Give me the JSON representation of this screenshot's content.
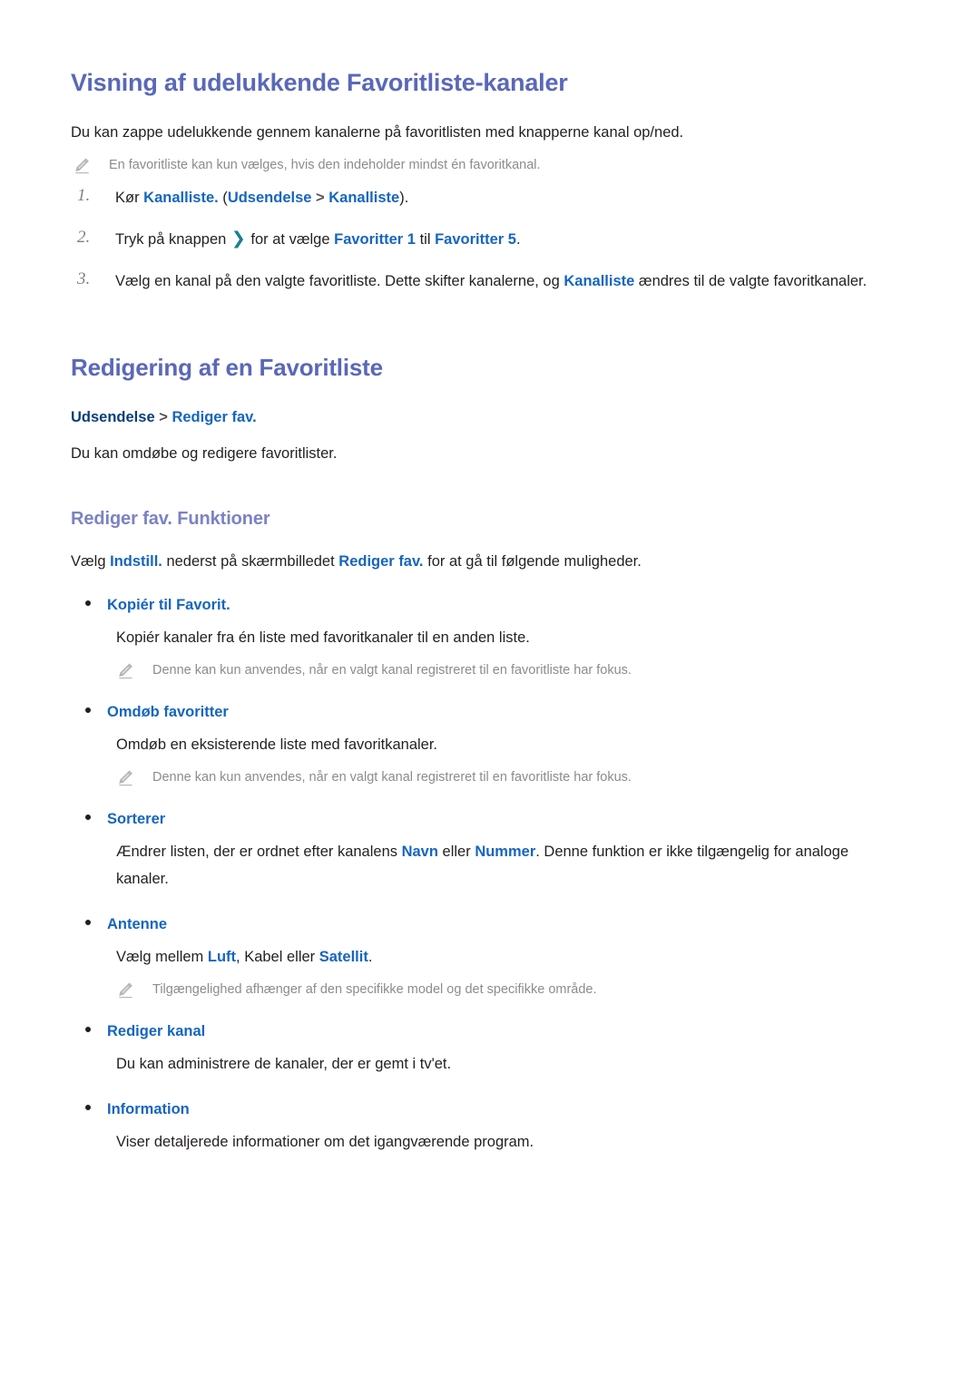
{
  "section1": {
    "heading": "Visning af udelukkende Favoritliste-kanaler",
    "intro": "Du kan zappe udelukkende gennem kanalerne på favoritlisten med knapperne kanal op/ned.",
    "note": "En favoritliste kan kun vælges, hvis den indeholder mindst én favoritkanal.",
    "steps": [
      {
        "number": "1.",
        "parts": [
          {
            "text": "Kør ",
            "style": "plain"
          },
          {
            "text": "Kanalliste.",
            "style": "bold-blue"
          },
          {
            "text": " (",
            "style": "plain"
          },
          {
            "text": "Udsendelse",
            "style": "bold-blue"
          },
          {
            "text": " > ",
            "style": "separator"
          },
          {
            "text": "Kanalliste",
            "style": "bold-blue"
          },
          {
            "text": ").",
            "style": "plain"
          }
        ]
      },
      {
        "number": "2.",
        "parts": [
          {
            "text": "Tryk på knappen ",
            "style": "plain"
          },
          {
            "text": "❯",
            "style": "chevron"
          },
          {
            "text": " for at vælge ",
            "style": "plain"
          },
          {
            "text": "Favoritter 1",
            "style": "bold-blue"
          },
          {
            "text": " til ",
            "style": "plain"
          },
          {
            "text": "Favoritter 5",
            "style": "bold-blue"
          },
          {
            "text": ".",
            "style": "plain"
          }
        ]
      },
      {
        "number": "3.",
        "parts": [
          {
            "text": "Vælg en kanal på den valgte favoritliste. Dette skifter kanalerne, og ",
            "style": "plain"
          },
          {
            "text": "Kanalliste",
            "style": "bold-blue"
          },
          {
            "text": " ændres til de valgte favoritkanaler.",
            "style": "plain"
          }
        ]
      }
    ]
  },
  "section2": {
    "heading": "Redigering af en Favoritliste",
    "breadcrumb": {
      "root": "Udsendelse",
      "separator": " > ",
      "leaf": "Rediger fav."
    },
    "intro": "Du kan omdøbe og redigere favoritlister.",
    "subheading": "Rediger fav. Funktioner",
    "lead_parts": [
      {
        "text": "Vælg ",
        "style": "plain"
      },
      {
        "text": "Indstill.",
        "style": "bold-blue"
      },
      {
        "text": " nederst på skærmbilledet ",
        "style": "plain"
      },
      {
        "text": "Rediger fav.",
        "style": "bold-blue"
      },
      {
        "text": " for at gå til følgende muligheder.",
        "style": "plain"
      }
    ],
    "options": [
      {
        "label": "Kopiér til Favorit.",
        "body_parts": [
          {
            "text": "Kopiér kanaler fra én liste med favoritkanaler til en anden liste.",
            "style": "plain"
          }
        ],
        "note": "Denne kan kun anvendes, når en valgt kanal registreret til en favoritliste har fokus."
      },
      {
        "label": "Omdøb favoritter",
        "body_parts": [
          {
            "text": "Omdøb en eksisterende liste med favoritkanaler.",
            "style": "plain"
          }
        ],
        "note": "Denne kan kun anvendes, når en valgt kanal registreret til en favoritliste har fokus."
      },
      {
        "label": "Sorterer",
        "body_parts": [
          {
            "text": "Ændrer listen, der er ordnet efter kanalens ",
            "style": "plain"
          },
          {
            "text": "Navn",
            "style": "bold-blue"
          },
          {
            "text": " eller ",
            "style": "plain"
          },
          {
            "text": "Nummer",
            "style": "bold-blue"
          },
          {
            "text": ". Denne funktion er ikke tilgængelig for analoge kanaler.",
            "style": "plain"
          }
        ],
        "note": ""
      },
      {
        "label": "Antenne",
        "body_parts": [
          {
            "text": "Vælg mellem ",
            "style": "plain"
          },
          {
            "text": "Luft",
            "style": "bold-blue"
          },
          {
            "text": ", Kabel  eller ",
            "style": "plain"
          },
          {
            "text": "Satellit",
            "style": "bold-blue"
          },
          {
            "text": ".",
            "style": "plain"
          }
        ],
        "note": "Tilgængelighed afhænger af den specifikke model og det specifikke område."
      },
      {
        "label": "Rediger kanal",
        "body_parts": [
          {
            "text": "Du kan administrere de kanaler, der er gemt i tv'et.",
            "style": "plain"
          }
        ],
        "note": ""
      },
      {
        "label": "Information",
        "body_parts": [
          {
            "text": "Viser detaljerede informationer om det igangværende program.",
            "style": "plain"
          }
        ],
        "note": ""
      }
    ]
  },
  "icons": {
    "note": "pencil-icon",
    "bullet": "bullet-dot-icon"
  },
  "colors": {
    "h1": "#5a68b8",
    "h3": "#7b82c4",
    "link_blue": "#1565c0",
    "breadcrumb_root": "#0d3d7c",
    "note_gray": "#8c8c8c",
    "body": "#231f20",
    "chevron_teal": "#1a7f92"
  }
}
